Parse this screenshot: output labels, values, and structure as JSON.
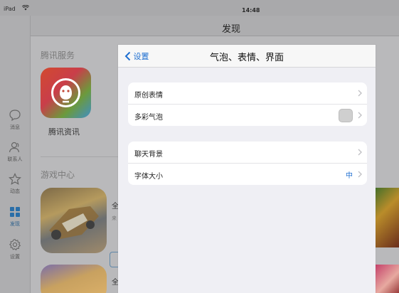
{
  "status_bar": {
    "device": "iPad",
    "time": "14:48"
  },
  "nav": {
    "title": "发现"
  },
  "tabs": [
    {
      "label": "消息",
      "icon": "chat-bubble-icon"
    },
    {
      "label": "联系人",
      "icon": "contacts-icon"
    },
    {
      "label": "动态",
      "icon": "star-icon"
    },
    {
      "label": "发现",
      "icon": "grid-icon",
      "active": true
    },
    {
      "label": "设置",
      "icon": "gear-icon"
    }
  ],
  "background": {
    "tencent_section": "腾讯服务",
    "tencent_label": "腾讯资讯",
    "games_section": "游戏中心",
    "peek_1": "全",
    "peek_2": "来",
    "peek_3": "全"
  },
  "modal": {
    "back_label": "设置",
    "title": "气泡、表情、界面",
    "groups": [
      {
        "rows": [
          {
            "label": "原创表情"
          },
          {
            "label": "多彩气泡"
          }
        ]
      },
      {
        "rows": [
          {
            "label": "聊天背景"
          },
          {
            "label": "字体大小",
            "value": "中"
          }
        ]
      }
    ]
  },
  "colors": {
    "accent": "#1f6fd1",
    "modal_background": "#efeff4",
    "dim_overlay": "#b9b9bb"
  }
}
